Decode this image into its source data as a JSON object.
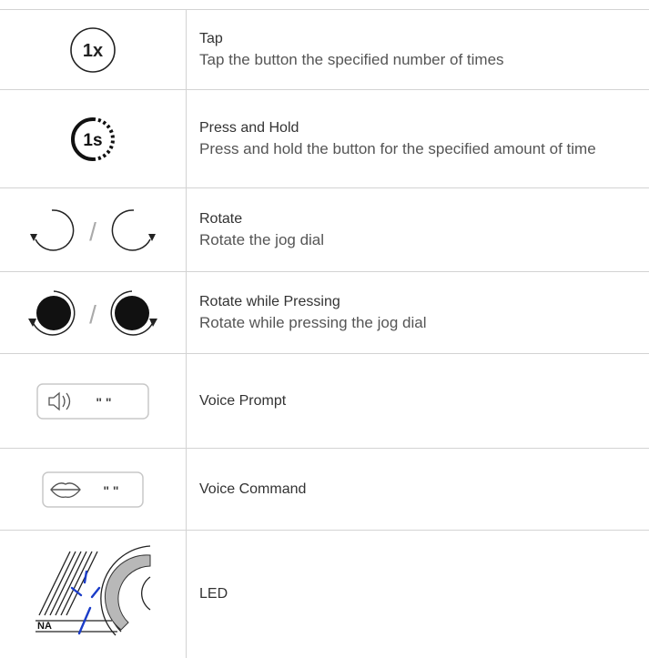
{
  "rows": [
    {
      "icon": "tap-1x-icon",
      "icon_text": "1x",
      "title": "Tap",
      "description": "Tap the button the specified number of times"
    },
    {
      "icon": "press-hold-1s-icon",
      "icon_text": "1s",
      "title": "Press and Hold",
      "description": "Press and hold the button for the specified amount of time"
    },
    {
      "icon": "rotate-icon",
      "icon_text": "/",
      "title": "Rotate",
      "description": "Rotate the jog dial"
    },
    {
      "icon": "rotate-pressing-icon",
      "icon_text": "/",
      "title": "Rotate while Pressing",
      "description": "Rotate while pressing the jog dial"
    },
    {
      "icon": "voice-prompt-icon",
      "icon_text": "\" \"",
      "title": "Voice Prompt",
      "description": ""
    },
    {
      "icon": "voice-command-icon",
      "icon_text": "\" \"",
      "title": "Voice Command",
      "description": ""
    },
    {
      "icon": "led-icon",
      "icon_text": "NA",
      "title": "LED",
      "description": ""
    }
  ],
  "colors": {
    "border": "#d3d3d3",
    "text": "#333333",
    "led_blue": "#1a3cc8"
  }
}
